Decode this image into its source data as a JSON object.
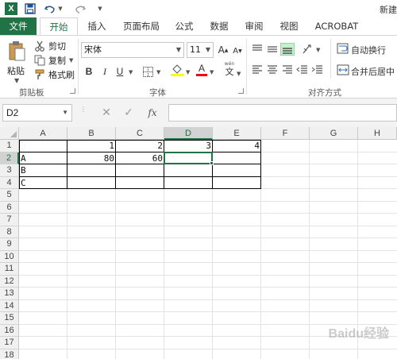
{
  "app": {
    "title_partial": "新建"
  },
  "quick_access": {
    "logo_letter": "X"
  },
  "tabs": [
    {
      "label": "文件"
    },
    {
      "label": "开始"
    },
    {
      "label": "插入"
    },
    {
      "label": "页面布局"
    },
    {
      "label": "公式"
    },
    {
      "label": "数据"
    },
    {
      "label": "审阅"
    },
    {
      "label": "视图"
    },
    {
      "label": "ACROBAT"
    }
  ],
  "ribbon": {
    "clipboard": {
      "paste_label": "粘贴",
      "cut_label": "剪切",
      "copy_label": "复制",
      "format_painter_label": "格式刷",
      "group_label": "剪贴板"
    },
    "font": {
      "font_name": "宋体",
      "font_size": "11",
      "grow_label": "A",
      "shrink_label": "A",
      "bold_label": "B",
      "italic_label": "I",
      "underline_label": "U",
      "font_color_label": "A",
      "phonetic_label": "wén",
      "phonetic_char": "文",
      "group_label": "字体",
      "fill_color": "#ffff00",
      "text_color": "#ff0000"
    },
    "alignment": {
      "wrap_text_label": "自动换行",
      "merge_center_label": "合并后居中",
      "group_label": "对齐方式"
    }
  },
  "formula_bar": {
    "name_box": "D2",
    "cancel_symbol": "✕",
    "enter_symbol": "✓",
    "fx_label": "fx",
    "formula": ""
  },
  "sheet": {
    "columns": [
      "A",
      "B",
      "C",
      "D",
      "E",
      "F",
      "G",
      "H"
    ],
    "selected_column": "D",
    "rows": [
      "1",
      "2",
      "3",
      "4",
      "5",
      "6",
      "7",
      "8",
      "9",
      "10",
      "11",
      "12",
      "13",
      "14",
      "15",
      "16",
      "17",
      "18"
    ],
    "selected_row": "2",
    "cells": {
      "B1": "1",
      "C1": "2",
      "D1": "3",
      "E1": "4",
      "A2": "A",
      "B2": "80",
      "C2": "60",
      "A3": "B",
      "A4": "C"
    },
    "active_cell": "D2"
  },
  "watermark": "Baidu经验"
}
